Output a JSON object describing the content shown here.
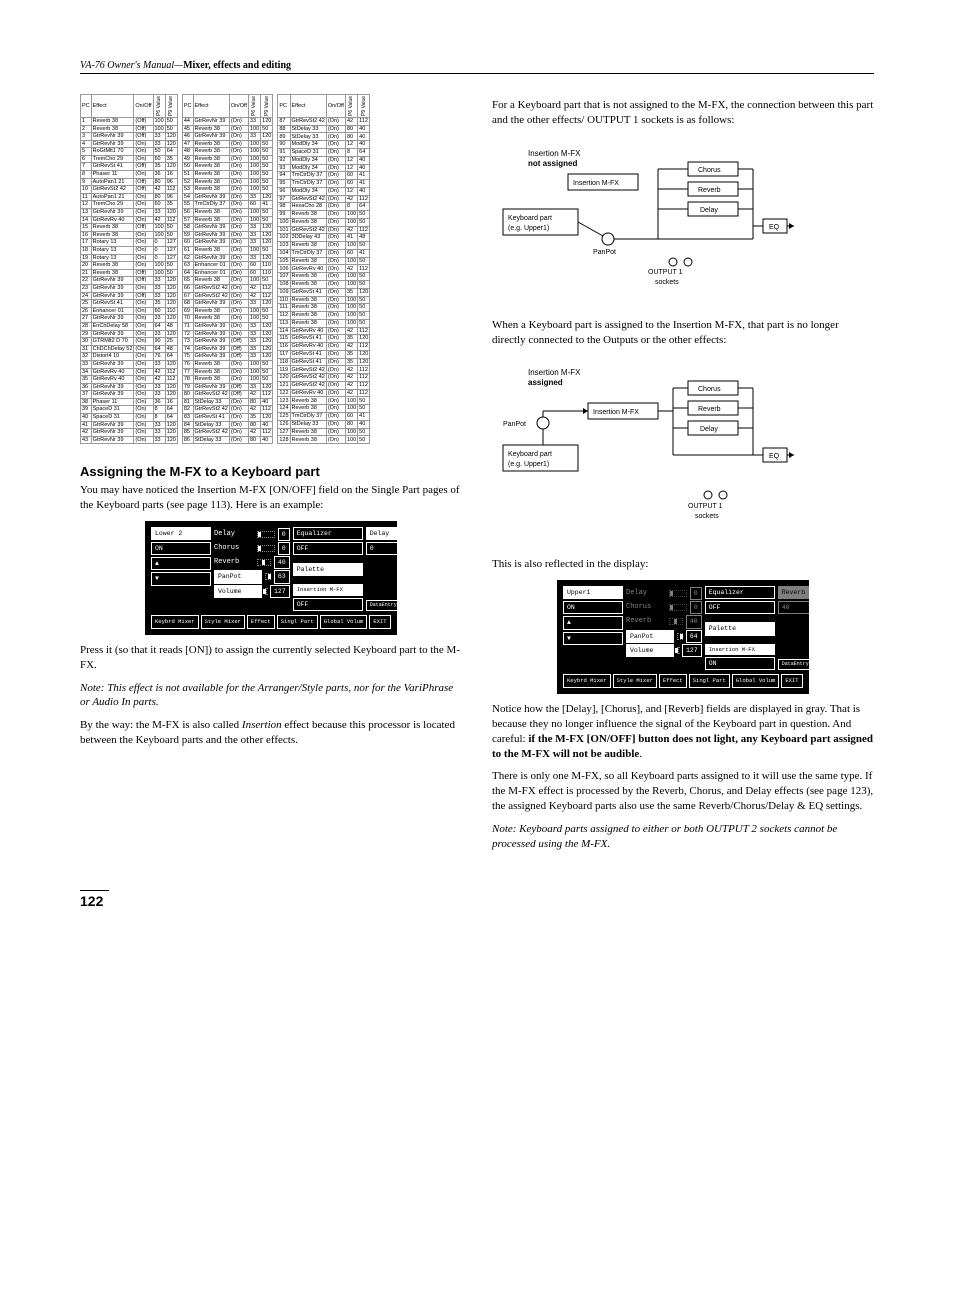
{
  "header": {
    "prefix": "VA-76 Owner's Manual—",
    "title": "Mixer, effects and editing"
  },
  "tables": {
    "headers": [
      "PC",
      "Effect",
      "On/Off",
      "P6 Value",
      "P9 Value"
    ],
    "t1": [
      [
        "1",
        "Reverb 38",
        "(Off)",
        "100",
        "50"
      ],
      [
        "2",
        "Reverb 38",
        "(Off)",
        "100",
        "50"
      ],
      [
        "3",
        "GtrRevNr 39",
        "(Off)",
        "33",
        "120"
      ],
      [
        "4",
        "GtrRevNr 39",
        "(On)",
        "33",
        "120"
      ],
      [
        "5",
        "RoGtMlt1 70",
        "(On)",
        "50",
        "64"
      ],
      [
        "6",
        "TremCho 29",
        "(On)",
        "60",
        "35"
      ],
      [
        "7",
        "GtrRevSt 41",
        "(Off)",
        "35",
        "120"
      ],
      [
        "8",
        "Phaser 11",
        "(On)",
        "36",
        "16"
      ],
      [
        "9",
        "AutoPan1 21",
        "(Off)",
        "80",
        "96"
      ],
      [
        "10",
        "GtrRevSt2 42",
        "(Off)",
        "42",
        "112"
      ],
      [
        "11",
        "AutoPan1 21",
        "(On)",
        "80",
        "96"
      ],
      [
        "12",
        "TremCho 29",
        "(On)",
        "60",
        "35"
      ],
      [
        "13",
        "GtrRevNr 39",
        "(On)",
        "33",
        "120"
      ],
      [
        "14",
        "GtrRevRv 40",
        "(On)",
        "42",
        "112"
      ],
      [
        "15",
        "Reverb 38",
        "(Off)",
        "100",
        "50"
      ],
      [
        "16",
        "Reverb 38",
        "(On)",
        "100",
        "50"
      ],
      [
        "17",
        "Rotary 13",
        "(On)",
        "0",
        "127"
      ],
      [
        "18",
        "Rotary 13",
        "(On)",
        "0",
        "127"
      ],
      [
        "19",
        "Rotary 13",
        "(On)",
        "0",
        "127"
      ],
      [
        "20",
        "Reverb 38",
        "(On)",
        "100",
        "50"
      ],
      [
        "21",
        "Reverb 38",
        "(Off)",
        "100",
        "50"
      ],
      [
        "22",
        "GtrRevNr 39",
        "(Off)",
        "33",
        "120"
      ],
      [
        "23",
        "GtrRevNr 39",
        "(On)",
        "33",
        "120"
      ],
      [
        "24",
        "GtrRevNr 39",
        "(Off)",
        "33",
        "120"
      ],
      [
        "25",
        "GtrRevSt 41",
        "(On)",
        "35",
        "120"
      ],
      [
        "26",
        "Enhancer 01",
        "(On)",
        "60",
        "110"
      ],
      [
        "27",
        "GtrRevNr 39",
        "(On)",
        "33",
        "120"
      ],
      [
        "28",
        "EnChDelay 58",
        "(On)",
        "64",
        "48"
      ],
      [
        "29",
        "GtrRevNr 39",
        "(On)",
        "33",
        "120"
      ],
      [
        "30",
        "GTRMlt2 D 70",
        "(On)",
        "90",
        "25"
      ],
      [
        "31",
        "ChDChDelay 52",
        "(On)",
        "64",
        "48"
      ],
      [
        "32",
        "Distort4 10",
        "(On)",
        "76",
        "64"
      ],
      [
        "33",
        "GtrRevNr 39",
        "(On)",
        "33",
        "120"
      ],
      [
        "34",
        "GtrRevRv 40",
        "(On)",
        "42",
        "112"
      ],
      [
        "35",
        "GtrRevRv 40",
        "(On)",
        "42",
        "112"
      ],
      [
        "36",
        "GtrRevNr 39",
        "(On)",
        "33",
        "120"
      ],
      [
        "37",
        "GtrRevNr 39",
        "(On)",
        "33",
        "120"
      ],
      [
        "38",
        "Phaser 11",
        "(On)",
        "36",
        "16"
      ],
      [
        "39",
        "SpaceD 31",
        "(On)",
        "8",
        "64"
      ],
      [
        "40",
        "SpaceD 31",
        "(On)",
        "8",
        "64"
      ],
      [
        "41",
        "GtrRevNr 39",
        "(On)",
        "33",
        "120"
      ],
      [
        "42",
        "GtrRevNr 39",
        "(On)",
        "33",
        "120"
      ],
      [
        "43",
        "GtrRevNr 39",
        "(On)",
        "33",
        "120"
      ]
    ],
    "t2": [
      [
        "44",
        "GtrRevNr 39",
        "(On)",
        "33",
        "120"
      ],
      [
        "45",
        "Reverb 38",
        "(On)",
        "100",
        "50"
      ],
      [
        "46",
        "GtrRevNr 39",
        "(On)",
        "33",
        "120"
      ],
      [
        "47",
        "Reverb 38",
        "(On)",
        "100",
        "50"
      ],
      [
        "48",
        "Reverb 38",
        "(On)",
        "100",
        "50"
      ],
      [
        "49",
        "Reverb 38",
        "(On)",
        "100",
        "50"
      ],
      [
        "50",
        "Reverb 38",
        "(On)",
        "100",
        "50"
      ],
      [
        "51",
        "Reverb 38",
        "(On)",
        "100",
        "50"
      ],
      [
        "52",
        "Reverb 38",
        "(On)",
        "100",
        "50"
      ],
      [
        "53",
        "Reverb 38",
        "(On)",
        "100",
        "50"
      ],
      [
        "54",
        "GtrRevNr 39",
        "(On)",
        "33",
        "120"
      ],
      [
        "55",
        "TmCtrDly 37",
        "(On)",
        "60",
        "41"
      ],
      [
        "56",
        "Reverb 38",
        "(On)",
        "100",
        "50"
      ],
      [
        "57",
        "Reverb 38",
        "(On)",
        "100",
        "50"
      ],
      [
        "58",
        "GtrRevNr 39",
        "(On)",
        "33",
        "120"
      ],
      [
        "59",
        "GtrRevNr 39",
        "(On)",
        "33",
        "120"
      ],
      [
        "60",
        "GtrRevNr 39",
        "(On)",
        "33",
        "120"
      ],
      [
        "61",
        "Reverb 38",
        "(On)",
        "100",
        "50"
      ],
      [
        "62",
        "GtrRevNr 39",
        "(On)",
        "33",
        "120"
      ],
      [
        "63",
        "Enhancer 01",
        "(On)",
        "60",
        "110"
      ],
      [
        "64",
        "Enhancer 01",
        "(On)",
        "60",
        "110"
      ],
      [
        "65",
        "Reverb 38",
        "(On)",
        "100",
        "50"
      ],
      [
        "66",
        "GtrRevSt2 42",
        "(On)",
        "42",
        "112"
      ],
      [
        "67",
        "GtrRevSt2 42",
        "(On)",
        "42",
        "112"
      ],
      [
        "68",
        "GtrRevNr 39",
        "(On)",
        "33",
        "120"
      ],
      [
        "69",
        "Reverb 38",
        "(On)",
        "100",
        "50"
      ],
      [
        "70",
        "Reverb 38",
        "(On)",
        "100",
        "50"
      ],
      [
        "71",
        "GtrRevNr 39",
        "(On)",
        "33",
        "120"
      ],
      [
        "72",
        "GtrRevNr 39",
        "(On)",
        "33",
        "120"
      ],
      [
        "73",
        "GtrRevNr 39",
        "(Off)",
        "33",
        "120"
      ],
      [
        "74",
        "GtrRevNr 39",
        "(Off)",
        "33",
        "120"
      ],
      [
        "75",
        "GtrRevNr 39",
        "(Off)",
        "33",
        "120"
      ],
      [
        "76",
        "Reverb 38",
        "(On)",
        "100",
        "50"
      ],
      [
        "77",
        "Reverb 38",
        "(On)",
        "100",
        "50"
      ],
      [
        "78",
        "Reverb 38",
        "(On)",
        "100",
        "50"
      ],
      [
        "79",
        "GtrRevNr 39",
        "(Off)",
        "33",
        "120"
      ],
      [
        "80",
        "GtrRevSt2 42",
        "(Off)",
        "42",
        "112"
      ],
      [
        "81",
        "StDelay 33",
        "(On)",
        "80",
        "40"
      ],
      [
        "82",
        "GtrRevSt2 42",
        "(On)",
        "42",
        "112"
      ],
      [
        "83",
        "GtrRevSt 41",
        "(On)",
        "35",
        "120"
      ],
      [
        "84",
        "StDelay 33",
        "(On)",
        "80",
        "40"
      ],
      [
        "85",
        "GtrRevSt2 42",
        "(On)",
        "42",
        "112"
      ],
      [
        "86",
        "StDelay 33",
        "(On)",
        "80",
        "40"
      ]
    ],
    "t3": [
      [
        "87",
        "GtrRevSt2 42",
        "(On)",
        "42",
        "112"
      ],
      [
        "88",
        "StDelay 33",
        "(On)",
        "80",
        "40"
      ],
      [
        "89",
        "StDelay 33",
        "(On)",
        "80",
        "40"
      ],
      [
        "90",
        "ModDly 34",
        "(On)",
        "12",
        "40"
      ],
      [
        "91",
        "SpaceD 31",
        "(On)",
        "8",
        "64"
      ],
      [
        "92",
        "ModDly 34",
        "(On)",
        "12",
        "40"
      ],
      [
        "93",
        "ModDly 34",
        "(On)",
        "12",
        "40"
      ],
      [
        "94",
        "TmCtrDly 37",
        "(On)",
        "60",
        "41"
      ],
      [
        "95",
        "TmCtrDly 37",
        "(On)",
        "60",
        "41"
      ],
      [
        "96",
        "ModDly 34",
        "(On)",
        "12",
        "40"
      ],
      [
        "97",
        "GtrRevSt2 42",
        "(On)",
        "42",
        "112"
      ],
      [
        "98",
        "HexaCho 28",
        "(On)",
        "8",
        "64"
      ],
      [
        "99",
        "Reverb 38",
        "(On)",
        "100",
        "50"
      ],
      [
        "100",
        "Reverb 38",
        "(On)",
        "100",
        "50"
      ],
      [
        "101",
        "GtrRevSt2 42",
        "(On)",
        "42",
        "112"
      ],
      [
        "102",
        "3DDelay 43",
        "(On)",
        "41",
        "48"
      ],
      [
        "103",
        "Reverb 38",
        "(On)",
        "100",
        "50"
      ],
      [
        "104",
        "TmCtrDly 37",
        "(On)",
        "60",
        "41"
      ],
      [
        "105",
        "Reverb 38",
        "(On)",
        "100",
        "50"
      ],
      [
        "106",
        "GtrRevRv 40",
        "(On)",
        "42",
        "112"
      ],
      [
        "107",
        "Reverb 38",
        "(On)",
        "100",
        "50"
      ],
      [
        "108",
        "Reverb 38",
        "(On)",
        "100",
        "50"
      ],
      [
        "109",
        "GtrRevSt 41",
        "(On)",
        "35",
        "120"
      ],
      [
        "110",
        "Reverb 38",
        "(On)",
        "100",
        "50"
      ],
      [
        "111",
        "Reverb 38",
        "(On)",
        "100",
        "50"
      ],
      [
        "112",
        "Reverb 38",
        "(On)",
        "100",
        "50"
      ],
      [
        "113",
        "Reverb 38",
        "(On)",
        "100",
        "50"
      ],
      [
        "114",
        "GtrRevRv 40",
        "(On)",
        "42",
        "112"
      ],
      [
        "115",
        "GtrRevSt 41",
        "(On)",
        "35",
        "120"
      ],
      [
        "116",
        "GtrRevRv 40",
        "(On)",
        "42",
        "112"
      ],
      [
        "117",
        "GtrRevSt 41",
        "(On)",
        "35",
        "120"
      ],
      [
        "118",
        "GtrRevSt 41",
        "(On)",
        "35",
        "120"
      ],
      [
        "119",
        "GtrRevSt2 42",
        "(On)",
        "42",
        "112"
      ],
      [
        "120",
        "GtrRevSt2 42",
        "(On)",
        "42",
        "112"
      ],
      [
        "121",
        "GtrRevSt2 42",
        "(On)",
        "42",
        "112"
      ],
      [
        "122",
        "GtrRevRv 40",
        "(On)",
        "42",
        "112"
      ],
      [
        "123",
        "Reverb 38",
        "(On)",
        "100",
        "50"
      ],
      [
        "124",
        "Reverb 38",
        "(On)",
        "100",
        "50"
      ],
      [
        "125",
        "TmCtrDly 37",
        "(On)",
        "60",
        "41"
      ],
      [
        "126",
        "StDelay 33",
        "(On)",
        "80",
        "40"
      ],
      [
        "127",
        "Reverb 38",
        "(On)",
        "100",
        "50"
      ],
      [
        "128",
        "Reverb 38",
        "(On)",
        "100",
        "50"
      ]
    ]
  },
  "section1": {
    "heading": "Assigning the M-FX to a Keyboard part",
    "p1": "You may have noticed the Insertion M-FX [ON/OFF] field on the Single Part pages of the Keyboard parts (see page 113). Here is an example:",
    "p2": "Press it (so that it reads [ON]) to assign the currently selected Keyboard part to the M-FX.",
    "note1": "Note: This effect is not available for the Arranger/Style parts, nor for the VariPhrase or Audio In parts.",
    "p3_a": "By the way: the M-FX is also called ",
    "p3_i": "Insertion",
    "p3_b": " effect because this processor is located between the Keyboard parts and the other effects."
  },
  "lcd1": {
    "part": "Lower 2",
    "on": "ON",
    "delay": "Delay",
    "delay_v": "0",
    "chorus": "Chorus",
    "chorus_v": "0",
    "reverb": "Reverb",
    "reverb_v": "40",
    "panpot": "PanPot",
    "panpot_v": "63",
    "volume": "Volume",
    "volume_v": "127",
    "equalizer": "Equalizer",
    "eq_off": "OFF",
    "palette": "Palette",
    "insmfx": "Insertion M-FX",
    "ins_off": "OFF",
    "dataentry": "DataEntry",
    "bottom": [
      "Keybrd Mixer",
      "Style Mixer",
      "Effect",
      "Singl Part",
      "Global Volum",
      "EXIT"
    ],
    "delay_btn": "Delay",
    "delay_btn_v": "0"
  },
  "col2": {
    "p1": "For a Keyboard part that is not assigned to the M-FX, the connection between this part and the other effects/ OUTPUT 1 sockets is as follows:",
    "p2": "When a Keyboard part is assigned to the Insertion M-FX, that part is no longer directly connected to the Outputs or the other effects:",
    "p3": "This is also reflected in the display:",
    "p4_a": "Notice how the [Delay], [Chorus], and [Reverb] fields are displayed in gray. That is because they no longer influence the signal of the Keyboard part in question. And careful: ",
    "p4_b": "if the M-FX [ON/OFF] button does not light, any Keyboard part assigned to the M-FX will not be audible",
    "p4_c": ".",
    "p5": "There is only one M-FX, so all Keyboard parts assigned to it will use the same type. If the M-FX effect is processed by the Reverb, Chorus, and Delay effects (see page 123), the assigned Keyboard parts also use the same Reverb/Chorus/Delay & EQ settings.",
    "note2": "Note: Keyboard parts assigned to either or both OUTPUT 2 sockets cannot be processed using the M-FX."
  },
  "diagram1": {
    "title1": "Insertion M-FX",
    "sub1": "not assigned",
    "ins": "Insertion M-FX",
    "kb": "Keyboard part\n(e.g. Upper1)",
    "chorus": "Chorus",
    "reverb": "Reverb",
    "delay": "Delay",
    "eq": "EQ",
    "panpot": "PanPot",
    "out": "OUTPUT 1\nsockets"
  },
  "diagram2": {
    "title1": "Insertion M-FX",
    "sub1": "assigned",
    "ins": "Insertion M-FX",
    "kb": "Keyboard part\n(e.g. Upper1)",
    "chorus": "Chorus",
    "reverb": "Reverb",
    "delay": "Delay",
    "eq": "EQ",
    "panpot": "PanPot",
    "out": "OUTPUT 1\nsockets"
  },
  "lcd2": {
    "part": "Upper1",
    "on": "ON",
    "delay": "Delay",
    "delay_v": "0",
    "chorus": "Chorus",
    "chorus_v": "0",
    "reverb": "Reverb",
    "reverb_v": "40",
    "panpot": "PanPot",
    "panpot_v": "64",
    "volume": "Volume",
    "volume_v": "127",
    "equalizer": "Equalizer",
    "eq_off": "OFF",
    "palette": "Palette",
    "insmfx": "Insertion M-FX",
    "ins_on": "ON",
    "dataentry": "DataEntry",
    "reverb_btn": "Reverb",
    "reverb_btn_v": "40",
    "bottom": [
      "Keybrd Mixer",
      "Style Mixer",
      "Effect",
      "Singl Part",
      "Global Volum",
      "EXIT"
    ]
  },
  "pagenum": "122"
}
